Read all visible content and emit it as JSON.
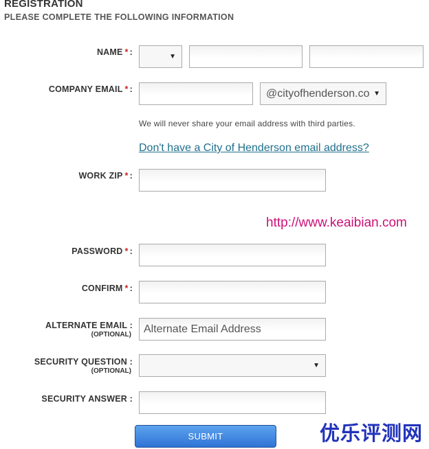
{
  "header": {
    "title": "REGISTRATION",
    "subtitle": "PLEASE COMPLETE THE FOLLOWING INFORMATION"
  },
  "form": {
    "required_marker": "*",
    "colon": ":",
    "name": {
      "label": "NAME",
      "prefix_value": "",
      "first_value": "",
      "last_value": ""
    },
    "company_email": {
      "label": "COMPANY EMAIL",
      "value": "",
      "domain_value": "@cityofhenderson.co",
      "note": "We will never share your email address with third parties.",
      "link": "Don't have a City of Henderson email address?"
    },
    "work_zip": {
      "label": "WORK ZIP",
      "value": ""
    },
    "password": {
      "label": "PASSWORD",
      "value": ""
    },
    "confirm": {
      "label": "CONFIRM",
      "value": ""
    },
    "alternate_email": {
      "label": "ALTERNATE EMAIL :",
      "optional": "(OPTIONAL)",
      "placeholder": "Alternate Email Address",
      "value": ""
    },
    "security_question": {
      "label": "SECURITY QUESTION :",
      "optional": "(OPTIONAL)",
      "value": ""
    },
    "security_answer": {
      "label": "SECURITY ANSWER :",
      "value": ""
    },
    "submit_label": "SUBMIT"
  },
  "watermarks": {
    "url": "http://www.keaibian.com",
    "site": "优乐评测网"
  },
  "colors": {
    "required": "#cc2222",
    "link": "#1f6f8b",
    "button_top": "#5ea3ee",
    "button_bottom": "#2f74d6",
    "watermark_url": "#cc1177",
    "watermark_site": "#2233bb"
  }
}
